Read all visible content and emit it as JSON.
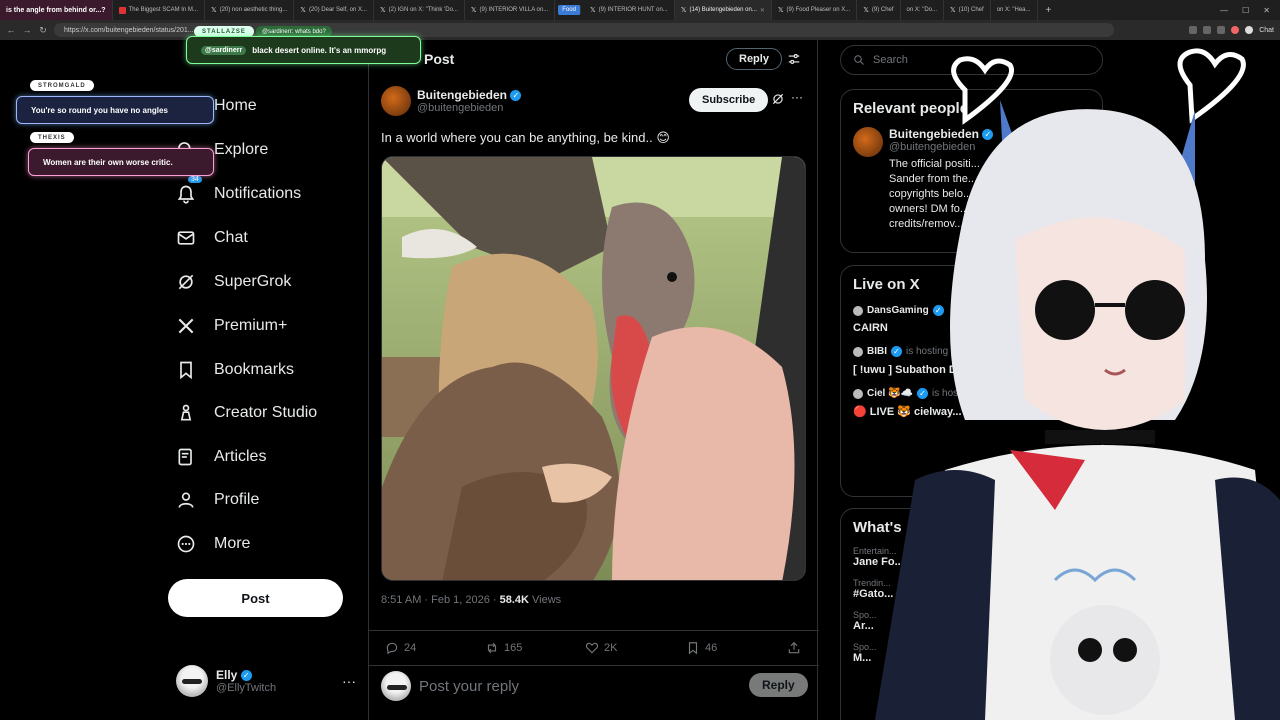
{
  "browser": {
    "tabs": [
      {
        "label": "The Biggest SCAM In M...",
        "active": false
      },
      {
        "label": "(20) non aesthetic thing...",
        "active": false
      },
      {
        "label": "(20) Dear Self, on X...",
        "active": false
      },
      {
        "label": "(2) IGN on X: \"Think 'Do...",
        "active": false
      },
      {
        "label": "(9) INTERIOR VILLA on...",
        "active": false
      },
      {
        "label": "Food",
        "active": false
      },
      {
        "label": "(9) INTERIOR HUNT on...",
        "active": false
      },
      {
        "label": "(14) Buitengebieden on...",
        "active": true
      },
      {
        "label": "(9) Food Pleaser on X...",
        "active": false
      },
      {
        "label": "(9) Chef",
        "active": false
      },
      {
        "label": "on X: \"Do...",
        "active": false
      },
      {
        "label": "(10) Chef",
        "active": false
      },
      {
        "label": "on X: \"Hea...",
        "active": false
      }
    ],
    "url": "https://x.com/buitengebieden/status/201...",
    "chat_label": "Chat"
  },
  "nav": {
    "home": "Home",
    "explore": "Explore",
    "notifications": "Notifications",
    "notif_badge": "34",
    "chat": "Chat",
    "supergrok": "SuperGrok",
    "premium": "Premium+",
    "bookmarks": "Bookmarks",
    "creator_studio": "Creator Studio",
    "articles": "Articles",
    "profile": "Profile",
    "more": "More",
    "post_button": "Post",
    "me_name": "Elly",
    "me_handle": "@EllyTwitch",
    "me_more": "···"
  },
  "main": {
    "header_title": "Post",
    "header_reply": "Reply",
    "author_name": "Buitengebieden",
    "author_handle": "@buitengebieden",
    "subscribe": "Subscribe",
    "text": "In a world where you can be anything, be kind.. 😊",
    "time": "8:51 AM · Feb 1, 2026 · ",
    "views_count": "58.4K",
    "views_label": " Views",
    "replies": "24",
    "reposts": "165",
    "likes": "2K",
    "bookmarks": "46",
    "reply_placeholder": "Post your reply",
    "reply_button": "Reply"
  },
  "right": {
    "search_placeholder": "Search",
    "relevant_title": "Relevant people",
    "rp_name": "Buitengebieden",
    "rp_handle": "@buitengebieden",
    "rp_bio": "The official positi... Sander from the... copyrights belo... owners! DM fo... credits/remov...",
    "live_title": "Live on X",
    "live": [
      {
        "host": "DansGaming",
        "hosting": "",
        "title": "CAIRN"
      },
      {
        "host": "BIBI",
        "hosting": "is hosting",
        "title": "[ !uwu ] Subathon Day 3 🤍 🗡 VOID - ..."
      },
      {
        "host": "Ciel 🐯☁️",
        "hosting": "is hosting",
        "title": "🔴 LIVE 🐯 cielway..."
      }
    ],
    "whats_title": "What's",
    "trends": [
      {
        "cat": "Entertain...",
        "name": "Jane Fo..."
      },
      {
        "cat": "Trendin...",
        "name": "#Gato..."
      },
      {
        "cat": "Spo...",
        "name": "Ar..."
      },
      {
        "cat": "Spo...",
        "name": "M..."
      }
    ]
  },
  "overlay": {
    "top_msg": "is the angle from behind or...?",
    "green_name": "STALLAZSE",
    "green_sub": "@sardinerr: whats bdo?",
    "green_mention": "@sardinerr",
    "green_msg": "black desert online. It's an mmorpg",
    "blue_name": "STROMGALD",
    "blue_msg": "You're so round you have no angles",
    "pink_name": "THEXIS",
    "pink_msg": "Women are their own worse critic."
  },
  "colors": {
    "accent": "#1d9bf0",
    "bg": "#000000",
    "border": "#2f3336",
    "muted": "#71767b"
  }
}
